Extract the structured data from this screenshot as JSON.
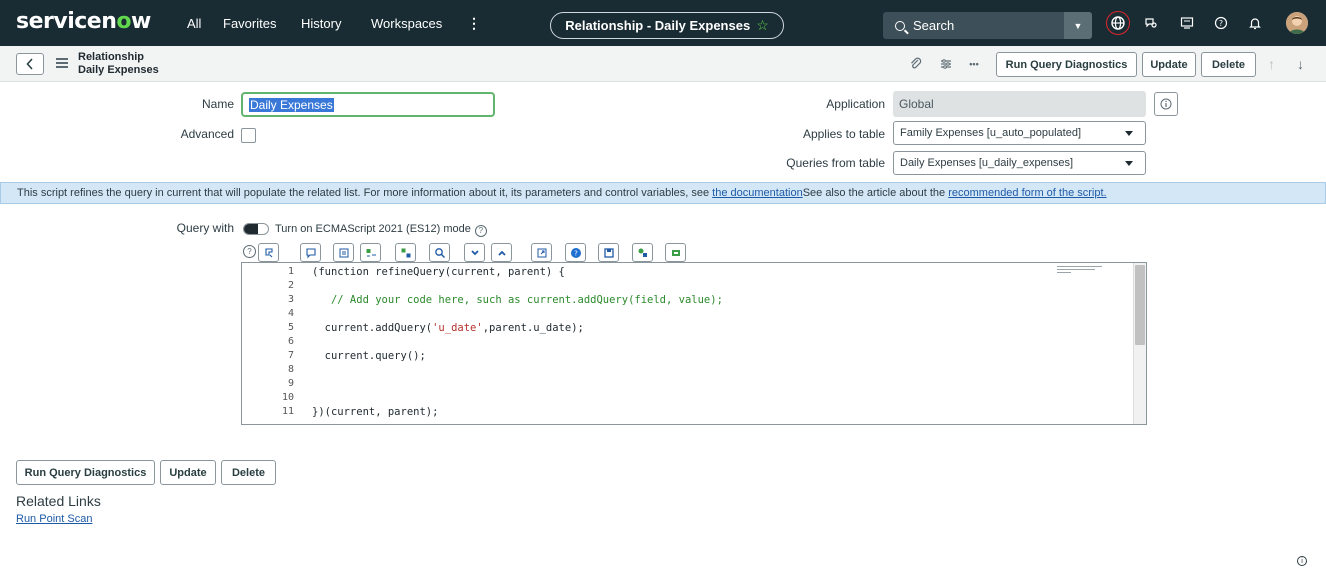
{
  "nav": {
    "logo_prefix": "servicen",
    "logo_o": "o",
    "logo_suffix": "w",
    "links": [
      "All",
      "Favorites",
      "History",
      "Workspaces"
    ],
    "more_glyph": "⋮",
    "context_title": "Relationship - Daily Expenses",
    "search_placeholder": "Search",
    "icons": [
      "globe-icon",
      "chat-search-icon",
      "screen-icon",
      "help-icon",
      "bell-icon",
      "avatar"
    ]
  },
  "header": {
    "title_line1": "Relationship",
    "title_line2": "Daily Expenses",
    "more_glyph": "•••",
    "buttons": {
      "diagnostics": "Run Query Diagnostics",
      "update": "Update",
      "delete": "Delete"
    },
    "up_arrow": "↑",
    "down_arrow": "↓"
  },
  "form": {
    "name_label": "Name",
    "name_value": "Daily Expenses",
    "advanced_label": "Advanced",
    "application_label": "Application",
    "application_value": "Global",
    "applies_label": "Applies to table",
    "applies_value": "Family Expenses [u_auto_populated]",
    "queries_label": "Queries from table",
    "queries_value": "Daily Expenses [u_daily_expenses]"
  },
  "banner": {
    "text1": "This script refines the query in current that will populate the related list. For more information about it, its parameters and control variables, see ",
    "link1": "the documentation",
    "text2": " See also the article about the ",
    "link2": "recommended form of the script."
  },
  "query": {
    "label": "Query with",
    "toggle_label": "Turn on ECMAScript 2021 (ES12) mode",
    "help_glyph": "?"
  },
  "editor": {
    "line_numbers": [
      "1",
      "2",
      "3",
      "4",
      "5",
      "6",
      "7",
      "8",
      "9",
      "10",
      "11"
    ],
    "lines": {
      "l1": "(function refineQuery(current, parent) {",
      "l3": "   // Add your code here, such as current.addQuery(field, value);",
      "l5a": "  current.addQuery(",
      "l5b": "'u_date'",
      "l5c": ",parent.u_date);",
      "l7": "  current.query();",
      "l11": "})(current, parent);"
    }
  },
  "bottom": {
    "buttons": {
      "diagnostics": "Run Query Diagnostics",
      "update": "Update",
      "delete": "Delete"
    },
    "related_title": "Related Links",
    "related_link": "Run Point Scan"
  }
}
